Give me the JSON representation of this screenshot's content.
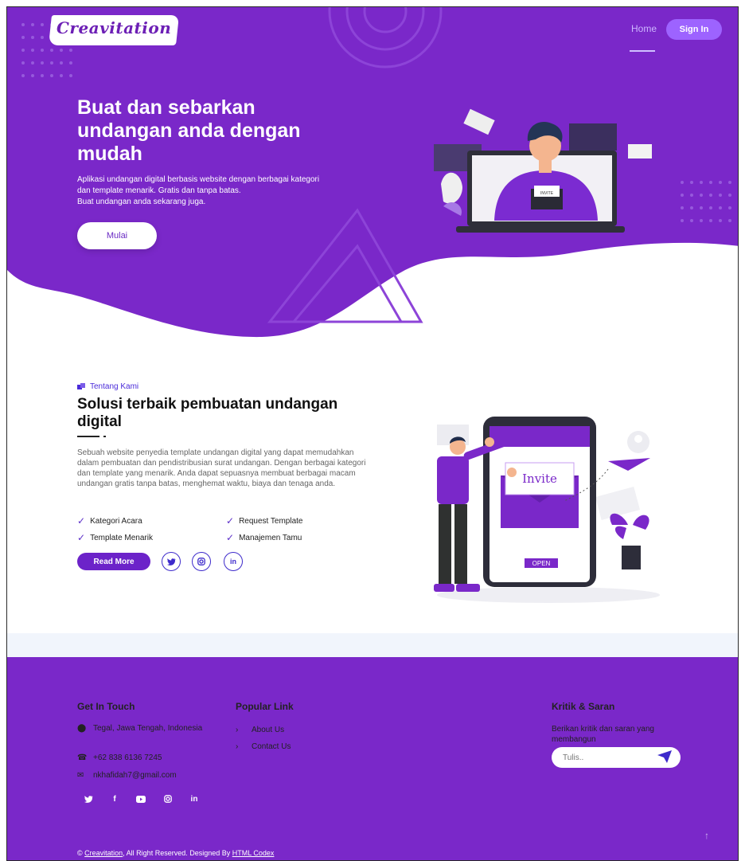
{
  "brand": {
    "name": "Creavitation"
  },
  "nav": {
    "home": "Home",
    "signin": "Sign In"
  },
  "hero": {
    "title": "Buat dan sebarkan undangan anda dengan mudah",
    "desc_line1": "Aplikasi undangan digital berbasis website dengan berbagai kategori",
    "desc_line2": "dan template menarik. Gratis dan tanpa batas.",
    "desc_line3": "Buat undangan anda sekarang juga.",
    "cta": "Mulai",
    "illustration_text": "INVITE"
  },
  "about": {
    "kicker": "Tentang Kami",
    "title": "Solusi terbaik pembuatan undangan digital",
    "desc": "Sebuah website penyedia template undangan digital yang dapat memudahkan dalam pembuatan dan pendistribusian surat undangan. Dengan berbagai kategori dan template yang menarik. Anda dapat sepuasnya membuat berbagai macam undangan gratis tanpa batas, menghemat waktu, biaya dan tenaga anda.",
    "features": [
      "Kategori Acara",
      "Request Template",
      "Template Menarik",
      "Manajemen Tamu"
    ],
    "read_more": "Read More",
    "socials": [
      "twitter-icon",
      "instagram-icon",
      "linkedin-icon"
    ],
    "illustration_invite": "Invite",
    "illustration_open": "OPEN"
  },
  "footer": {
    "contact_title": "Get In Touch",
    "address": "Tegal, Jawa Tengah, Indonesia",
    "phone": "+62 838 6136 7245",
    "email": "nkhafidah7@gmail.com",
    "popular_title": "Popular Link",
    "links": [
      "About Us",
      "Contact Us"
    ],
    "feedback_title": "Kritik & Saran",
    "feedback_desc": "Berikan kritik dan saran yang membangun",
    "feedback_placeholder": "Tulis..",
    "copyright_prefix": "© ",
    "copyright_brand": "Creavitation",
    "copyright_mid": ", All Right Reserved. Designed By ",
    "copyright_designer": "HTML Codex",
    "social_icons": [
      "twitter-icon",
      "facebook-icon",
      "youtube-icon",
      "instagram-icon",
      "linkedin-icon"
    ]
  },
  "colors": {
    "primary": "#7a28c9",
    "accent": "#9d63ff",
    "link": "#4a2bd9"
  }
}
